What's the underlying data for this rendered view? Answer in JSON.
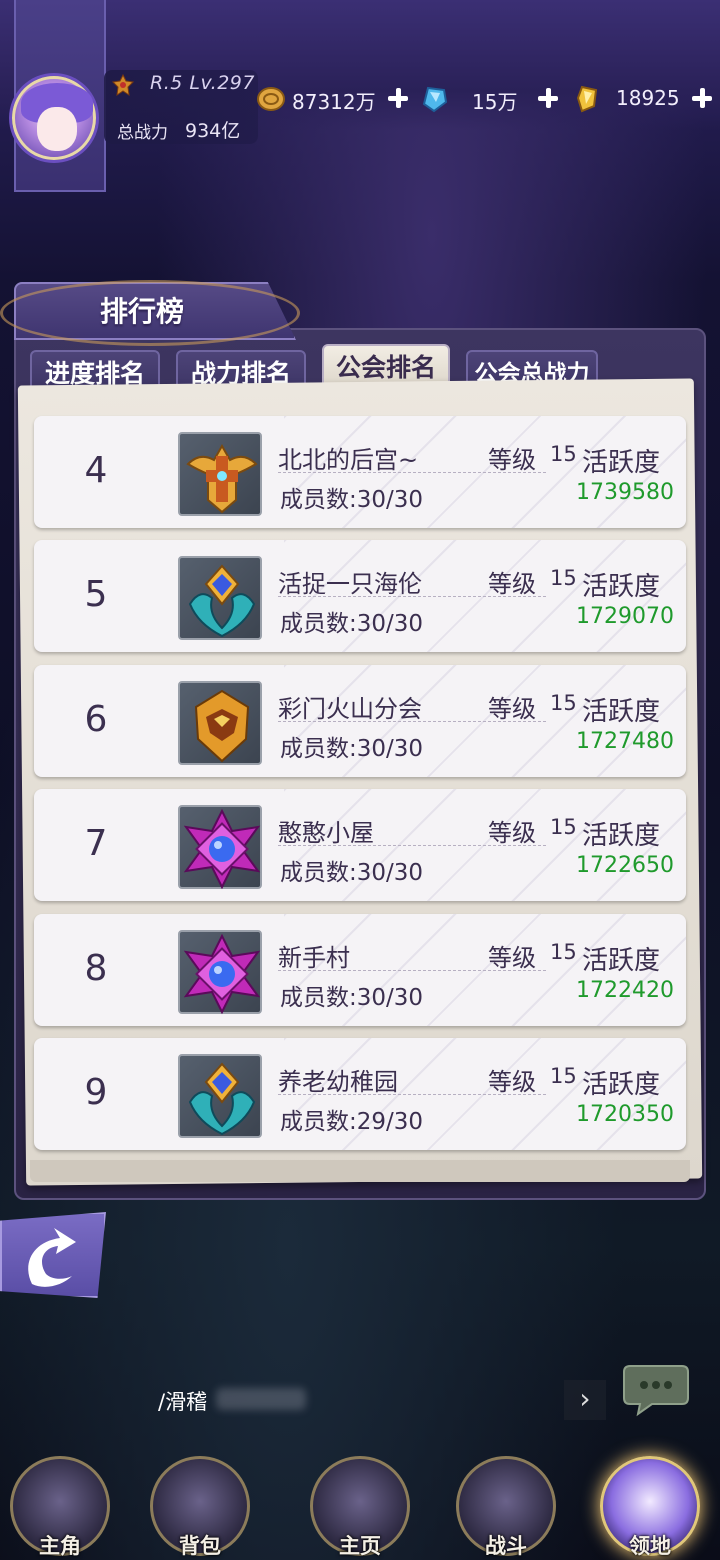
{
  "player": {
    "rank_level": "R.5 Lv.297",
    "power_label": "总战力",
    "power_value": "934亿"
  },
  "resources": [
    {
      "icon": "gold-coin-icon",
      "value": "87312万"
    },
    {
      "icon": "blue-crystal-icon",
      "value": "15万"
    },
    {
      "icon": "gold-crystal-icon",
      "value": "18925"
    }
  ],
  "panel": {
    "title": "排行榜",
    "tabs": [
      {
        "label": "进度排名",
        "active": false
      },
      {
        "label": "战力排名",
        "active": false
      },
      {
        "label": "公会排名",
        "active": true
      },
      {
        "label": "公会总战力",
        "active": false
      }
    ]
  },
  "labels": {
    "level": "等级",
    "activity": "活跃度"
  },
  "guilds": [
    {
      "rank": "4",
      "name": "北北的后宫~",
      "level": "15",
      "members": "成员数:30/30",
      "activity": "1739580",
      "emblem": "gold-winged-cross-emblem"
    },
    {
      "rank": "5",
      "name": "活捉一只海伦",
      "level": "15",
      "members": "成员数:30/30",
      "activity": "1729070",
      "emblem": "blue-crest-emblem"
    },
    {
      "rank": "6",
      "name": "彩门火山分会",
      "level": "15",
      "members": "成员数:30/30",
      "activity": "1727480",
      "emblem": "gold-helmet-emblem"
    },
    {
      "rank": "7",
      "name": "憨憨小屋",
      "level": "15",
      "members": "成员数:30/30",
      "activity": "1722650",
      "emblem": "purple-star-emblem"
    },
    {
      "rank": "8",
      "name": "新手村",
      "level": "15",
      "members": "成员数:30/30",
      "activity": "1722420",
      "emblem": "purple-star-emblem"
    },
    {
      "rank": "9",
      "name": "养老幼稚园",
      "level": "15",
      "members": "成员数:29/30",
      "activity": "1720350",
      "emblem": "blue-crest-emblem"
    }
  ],
  "chat": {
    "text": "/滑稽"
  },
  "bottom_nav": [
    {
      "label": "主角",
      "active": false
    },
    {
      "label": "背包",
      "active": false
    },
    {
      "label": "主页",
      "active": false
    },
    {
      "label": "战斗",
      "active": false
    },
    {
      "label": "领地",
      "active": true
    }
  ],
  "colors": {
    "activity_green": "#1f9a2c",
    "panel_purple": "#3d3560",
    "active_tab": "#f2ede4"
  }
}
